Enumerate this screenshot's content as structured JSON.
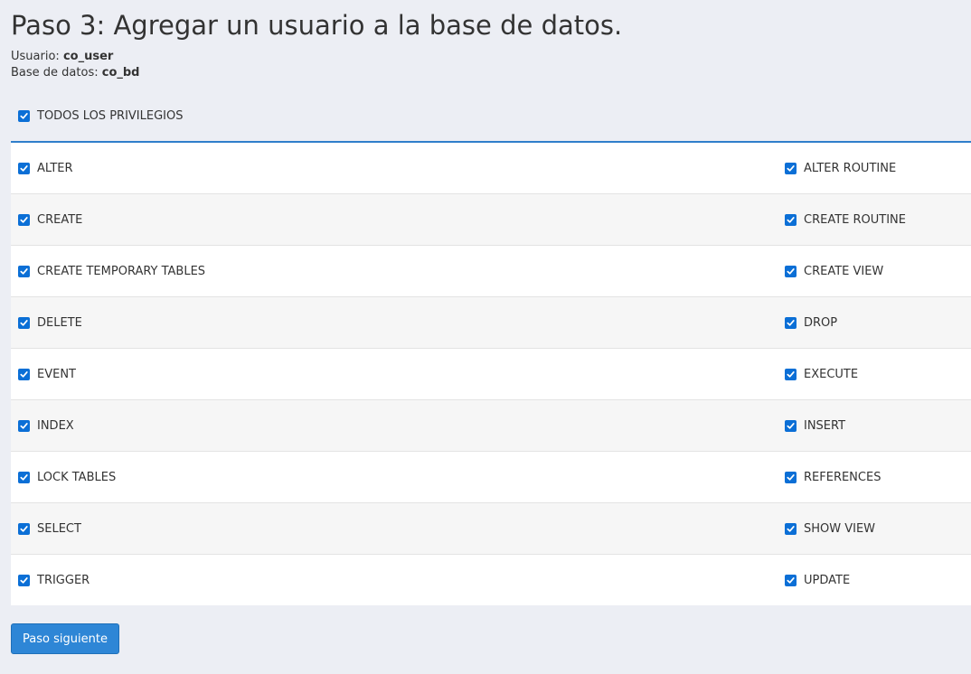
{
  "page": {
    "title": "Paso 3: Agregar un usuario a la base de datos."
  },
  "info": {
    "user_label": "Usuario:",
    "user_value": "co_user",
    "db_label": "Base de datos:",
    "db_value": "co_bd"
  },
  "all_privileges": {
    "label": "TODOS LOS PRIVILEGIOS",
    "checked": true
  },
  "privileges": [
    {
      "left": "ALTER",
      "right": "ALTER ROUTINE"
    },
    {
      "left": "CREATE",
      "right": "CREATE ROUTINE"
    },
    {
      "left": "CREATE TEMPORARY TABLES",
      "right": "CREATE VIEW"
    },
    {
      "left": "DELETE",
      "right": "DROP"
    },
    {
      "left": "EVENT",
      "right": "EXECUTE"
    },
    {
      "left": "INDEX",
      "right": "INSERT"
    },
    {
      "left": "LOCK TABLES",
      "right": "REFERENCES"
    },
    {
      "left": "SELECT",
      "right": "SHOW VIEW"
    },
    {
      "left": "TRIGGER",
      "right": "UPDATE"
    }
  ],
  "actions": {
    "next_label": "Paso siguiente"
  },
  "colors": {
    "checkbox": "#0b6fd6",
    "accent": "#2f7ecb",
    "button": "#2e86d6"
  }
}
